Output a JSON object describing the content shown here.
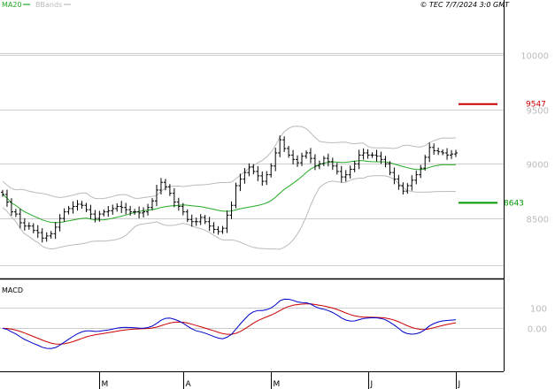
{
  "header": {
    "legend": [
      {
        "label": "MA20",
        "color": "#22aa22"
      },
      {
        "label": "BBands",
        "color": "#bbbbbb"
      }
    ],
    "copyright": "© TEC 7/7/2024 3:0 GMT"
  },
  "macd_panel": {
    "title": "MACD"
  },
  "levels": {
    "resistance": {
      "label": "9547",
      "value": 9547,
      "color": "#cc0000"
    },
    "support": {
      "label": "8643",
      "value": 8643,
      "color": "#009900"
    }
  },
  "colors": {
    "price": "#000000",
    "ma20": "#22aa22",
    "bbands": "#bbbbbb",
    "macd": "#0000cc",
    "signal": "#cc0000",
    "grid": "#cccccc",
    "axis_text": "#bbbbbb"
  },
  "chart_data": [
    {
      "type": "ohlc",
      "title": "",
      "ylim": [
        7950,
        10500
      ],
      "y_ticks": [
        {
          "value": 8500,
          "label": "8500"
        },
        {
          "value": 9000,
          "label": "9000"
        },
        {
          "value": 9500,
          "label": "9500"
        },
        {
          "value": 10000,
          "label": "10000"
        }
      ],
      "x_month_labels": [
        {
          "index": 22,
          "label": "M"
        },
        {
          "index": 41,
          "label": "A"
        },
        {
          "index": 61,
          "label": "M"
        },
        {
          "index": 83,
          "label": "J"
        },
        {
          "index": 103,
          "label": "J"
        }
      ],
      "close": [
        8720,
        8650,
        8560,
        8540,
        8460,
        8430,
        8430,
        8390,
        8370,
        8320,
        8340,
        8360,
        8420,
        8500,
        8560,
        8590,
        8610,
        8630,
        8620,
        8580,
        8540,
        8500,
        8540,
        8560,
        8570,
        8590,
        8610,
        8600,
        8580,
        8560,
        8560,
        8550,
        8560,
        8600,
        8660,
        8760,
        8830,
        8790,
        8730,
        8650,
        8610,
        8560,
        8490,
        8470,
        8470,
        8510,
        8470,
        8430,
        8400,
        8380,
        8410,
        8530,
        8620,
        8800,
        8860,
        8920,
        8970,
        8930,
        8890,
        8840,
        8900,
        8980,
        9100,
        9220,
        9140,
        9080,
        9040,
        9010,
        9070,
        9100,
        9050,
        8980,
        9000,
        9050,
        9020,
        8980,
        8930,
        8880,
        8900,
        8950,
        9000,
        9080,
        9100,
        9080,
        9080,
        9070,
        9040,
        9000,
        8920,
        8860,
        8800,
        8750,
        8800,
        8850,
        8900,
        8960,
        9060,
        9150,
        9120,
        9110,
        9100,
        9080,
        9090,
        9100
      ],
      "series": [
        {
          "name": "MA20"
        },
        {
          "name": "BBands"
        }
      ]
    },
    {
      "type": "line",
      "title": "MACD",
      "ylim": [
        -210,
        230
      ],
      "y_ticks": [
        {
          "value": 0,
          "label": "0.00"
        },
        {
          "value": 100,
          "label": "100"
        }
      ]
    }
  ]
}
